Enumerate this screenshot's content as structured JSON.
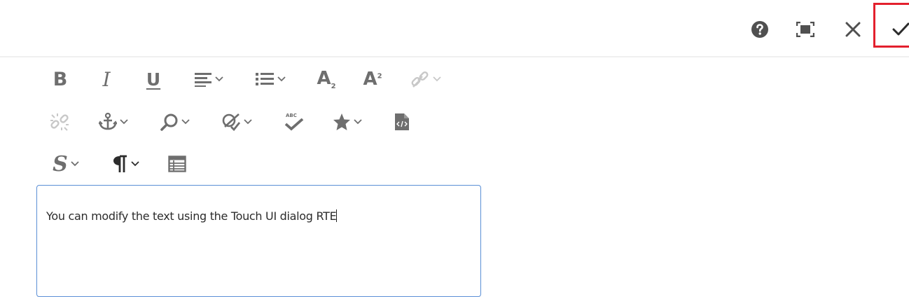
{
  "header": {
    "help_icon": "help-icon",
    "fullscreen_icon": "fullscreen-icon",
    "cancel_icon": "close-icon",
    "confirm_icon": "checkmark-icon",
    "highlight_color": "#e3202d"
  },
  "toolbar": {
    "row1": [
      "bold",
      "italic",
      "underline",
      "justify",
      "lists",
      "subscript",
      "superscript",
      "link"
    ],
    "row2": [
      "unlink",
      "anchor",
      "find-replace",
      "spellcheck-edit",
      "spellcheck",
      "special-characters",
      "source-edit"
    ],
    "row3": [
      "styles",
      "paragraph-format",
      "table"
    ],
    "labels": {
      "subscript": "A",
      "superscript": "A",
      "spellcheck_abc": "ABC"
    },
    "icon_color": "#6e6e6e",
    "disabled_color": "#c8c8c8"
  },
  "editor": {
    "content": "You can modify the text using the Touch UI dialog RTE"
  }
}
